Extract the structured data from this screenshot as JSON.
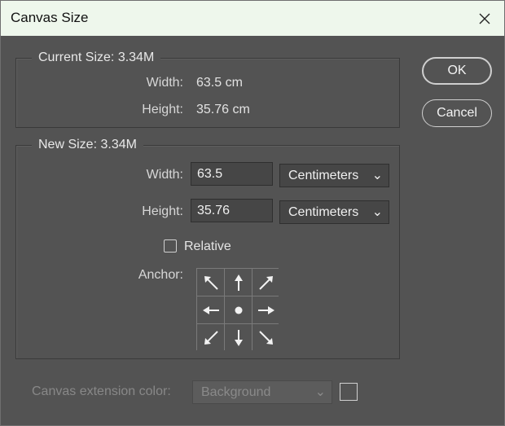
{
  "window": {
    "title": "Canvas Size"
  },
  "current_size": {
    "group_title": "Current Size: 3.34M",
    "width_label": "Width:",
    "width_value": "63.5 cm",
    "height_label": "Height:",
    "height_value": "35.76 cm"
  },
  "new_size": {
    "group_title": "New Size: 3.34M",
    "width_label": "Width:",
    "width_value": "63.5",
    "width_unit": "Centimeters",
    "height_label": "Height:",
    "height_value": "35.76",
    "height_unit": "Centimeters",
    "relative_label": "Relative",
    "relative_checked": false,
    "anchor_label": "Anchor:",
    "anchor_cells": [
      "arrow-up-left-icon",
      "arrow-up-icon",
      "arrow-up-right-icon",
      "arrow-left-icon",
      "anchor-center-dot-icon",
      "arrow-right-icon",
      "arrow-down-left-icon",
      "arrow-down-icon",
      "arrow-down-right-icon"
    ]
  },
  "buttons": {
    "ok": "OK",
    "cancel": "Cancel"
  },
  "extension": {
    "label": "Canvas extension color:",
    "value": "Background"
  },
  "colors": {
    "dialog_bg": "#535353",
    "titlebar_bg": "#eef7ec"
  }
}
